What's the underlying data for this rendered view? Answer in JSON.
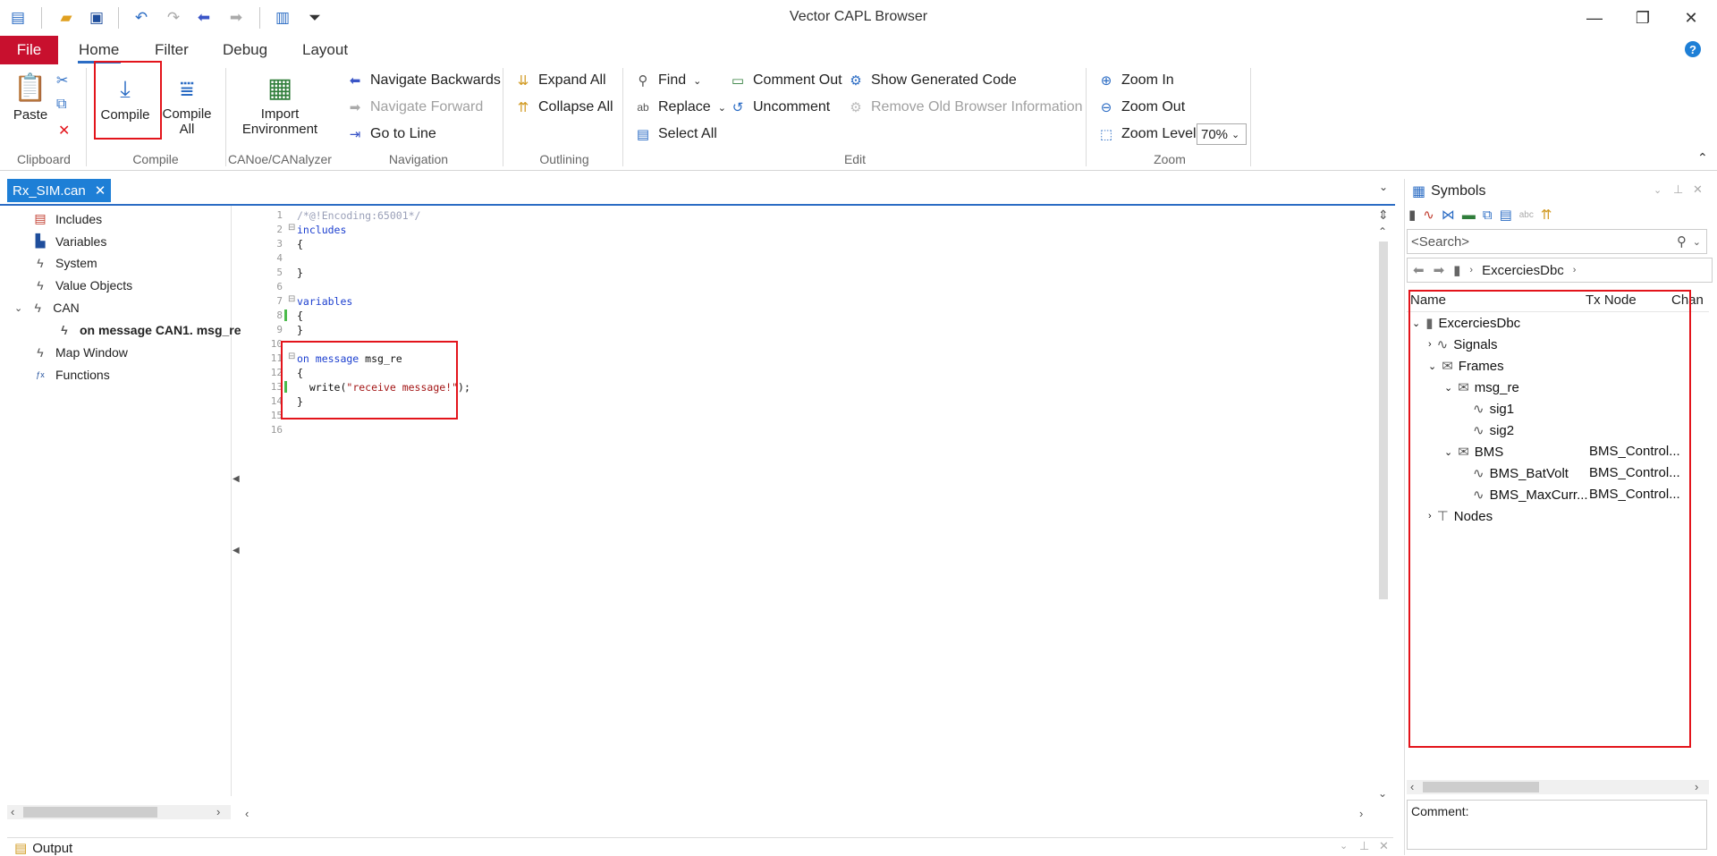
{
  "app": {
    "title": "Vector CAPL Browser"
  },
  "quick_access": [
    "new-icon",
    "open-icon",
    "save-icon",
    "undo-icon",
    "redo-icon",
    "back-icon",
    "forward-icon",
    "browse-icon",
    "customize-icon"
  ],
  "window_controls": {
    "minimize": "—",
    "restore": "❐",
    "close": "✕"
  },
  "ribbon_tabs": {
    "file": "File",
    "home": "Home",
    "filter": "Filter",
    "debug": "Debug",
    "layout": "Layout"
  },
  "help": "?",
  "ribbon": {
    "clipboard": {
      "label": "Clipboard",
      "paste": "Paste"
    },
    "compile": {
      "label": "Compile",
      "compile": "Compile",
      "compile_all_line1": "Compile",
      "compile_all_line2": "All"
    },
    "canoe": {
      "label": "CANoe/CANalyzer",
      "import_line1": "Import",
      "import_line2": "Environment"
    },
    "navigation": {
      "label": "Navigation",
      "back": "Navigate Backwards",
      "forward": "Navigate Forward",
      "goto": "Go to Line"
    },
    "outlining": {
      "label": "Outlining",
      "expand": "Expand All",
      "collapse": "Collapse All"
    },
    "edit": {
      "label": "Edit",
      "find": "Find",
      "replace": "Replace",
      "select_all": "Select All",
      "comment_out": "Comment Out",
      "uncomment": "Uncomment",
      "show_generated": "Show Generated Code",
      "remove_old": "Remove Old Browser Information"
    },
    "zoom": {
      "label": "Zoom",
      "zoom_in": "Zoom In",
      "zoom_out": "Zoom Out",
      "zoom_level": "Zoom Level",
      "zoom_value": "70%"
    }
  },
  "document_tab": {
    "name": "Rx_SIM.can",
    "close": "✕"
  },
  "left_tree": {
    "items": [
      {
        "label": "Includes"
      },
      {
        "label": "Variables"
      },
      {
        "label": "System"
      },
      {
        "label": "Value Objects"
      },
      {
        "label": "CAN"
      },
      {
        "label": "on message CAN1. msg_re"
      },
      {
        "label": "Map Window"
      },
      {
        "label": "Functions"
      }
    ]
  },
  "editor": {
    "line_numbers": [
      "1",
      "2",
      "3",
      "4",
      "5",
      "6",
      "7",
      "8",
      "9",
      "10",
      "11",
      "12",
      "13",
      "14",
      "15",
      "16"
    ],
    "lines": {
      "l1": "/*@!Encoding:65001*/",
      "l2": "includes",
      "l3": "{",
      "l5": "}",
      "l7": "variables",
      "l8": "{",
      "l9": "}",
      "l11_kw": "on message",
      "l11_name": " msg_re",
      "l12": "{",
      "l13_pre": "  write(",
      "l13_str": "\"receive message!\"",
      "l13_post": ");",
      "l14": "}"
    }
  },
  "symbols": {
    "title": "Symbols",
    "search_placeholder": "<Search>",
    "breadcrumb": "ExcerciesDbc",
    "columns": {
      "name": "Name",
      "tx_node": "Tx Node",
      "chan": "Chan"
    },
    "tree": [
      {
        "label": "ExcerciesDbc",
        "tx": ""
      },
      {
        "label": "Signals",
        "tx": ""
      },
      {
        "label": "Frames",
        "tx": ""
      },
      {
        "label": "msg_re",
        "tx": ""
      },
      {
        "label": "sig1",
        "tx": ""
      },
      {
        "label": "sig2",
        "tx": ""
      },
      {
        "label": "BMS",
        "tx": "BMS_Control..."
      },
      {
        "label": "BMS_BatVolt",
        "tx": "BMS_Control..."
      },
      {
        "label": "BMS_MaxCurr...",
        "tx": "BMS_Control..."
      },
      {
        "label": "Nodes",
        "tx": ""
      }
    ],
    "comment_label": "Comment:"
  },
  "output": {
    "title": "Output"
  }
}
